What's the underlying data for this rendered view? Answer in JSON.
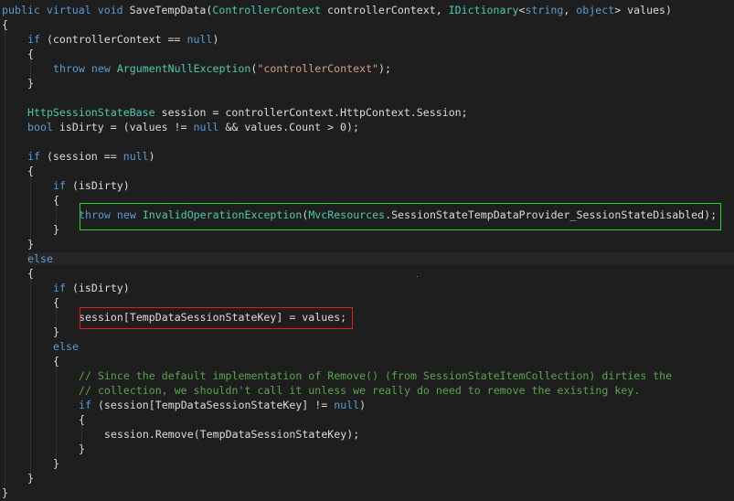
{
  "editor": {
    "language": "C#",
    "colors": {
      "background": "#1e1e1e",
      "keyword": "#569cd6",
      "type": "#4ec9b0",
      "string": "#d69d85",
      "comment": "#57a64a",
      "plain": "#dcdcdc",
      "highlight_green": "#2bd32b",
      "highlight_red": "#e21b1b"
    },
    "lines": [
      {
        "indent": 0,
        "tokens": [
          {
            "t": "public",
            "c": "kw"
          },
          {
            "t": " ",
            "c": "pl"
          },
          {
            "t": "virtual",
            "c": "kw"
          },
          {
            "t": " ",
            "c": "pl"
          },
          {
            "t": "void",
            "c": "kw"
          },
          {
            "t": " SaveTempData(",
            "c": "pl"
          },
          {
            "t": "ControllerContext",
            "c": "ty"
          },
          {
            "t": " controllerContext, ",
            "c": "pl"
          },
          {
            "t": "IDictionary",
            "c": "ty"
          },
          {
            "t": "<",
            "c": "pl"
          },
          {
            "t": "string",
            "c": "kw"
          },
          {
            "t": ", ",
            "c": "pl"
          },
          {
            "t": "object",
            "c": "kw"
          },
          {
            "t": "> values)",
            "c": "pl"
          }
        ]
      },
      {
        "indent": 0,
        "tokens": [
          {
            "t": "{",
            "c": "pl"
          }
        ]
      },
      {
        "indent": 4,
        "tokens": [
          {
            "t": "if",
            "c": "kw"
          },
          {
            "t": " (controllerContext == ",
            "c": "pl"
          },
          {
            "t": "null",
            "c": "kw"
          },
          {
            "t": ")",
            "c": "pl"
          }
        ]
      },
      {
        "indent": 4,
        "tokens": [
          {
            "t": "{",
            "c": "pl"
          }
        ]
      },
      {
        "indent": 8,
        "tokens": [
          {
            "t": "throw",
            "c": "kw"
          },
          {
            "t": " ",
            "c": "pl"
          },
          {
            "t": "new",
            "c": "kw"
          },
          {
            "t": " ",
            "c": "pl"
          },
          {
            "t": "ArgumentNullException",
            "c": "ty"
          },
          {
            "t": "(",
            "c": "pl"
          },
          {
            "t": "\"controllerContext\"",
            "c": "st"
          },
          {
            "t": ");",
            "c": "pl"
          }
        ]
      },
      {
        "indent": 4,
        "tokens": [
          {
            "t": "}",
            "c": "pl"
          }
        ]
      },
      {
        "indent": 0,
        "tokens": []
      },
      {
        "indent": 4,
        "tokens": [
          {
            "t": "HttpSessionStateBase",
            "c": "ty"
          },
          {
            "t": " session = controllerContext.HttpContext.Session;",
            "c": "pl"
          }
        ]
      },
      {
        "indent": 4,
        "tokens": [
          {
            "t": "bool",
            "c": "kw"
          },
          {
            "t": " isDirty = (values != ",
            "c": "pl"
          },
          {
            "t": "null",
            "c": "kw"
          },
          {
            "t": " && values.Count > 0);",
            "c": "pl"
          }
        ]
      },
      {
        "indent": 0,
        "tokens": []
      },
      {
        "indent": 4,
        "tokens": [
          {
            "t": "if",
            "c": "kw"
          },
          {
            "t": " (session == ",
            "c": "pl"
          },
          {
            "t": "null",
            "c": "kw"
          },
          {
            "t": ")",
            "c": "pl"
          }
        ]
      },
      {
        "indent": 4,
        "tokens": [
          {
            "t": "{",
            "c": "pl"
          }
        ]
      },
      {
        "indent": 8,
        "tokens": [
          {
            "t": "if",
            "c": "kw"
          },
          {
            "t": " (isDirty)",
            "c": "pl"
          }
        ]
      },
      {
        "indent": 8,
        "tokens": [
          {
            "t": "{",
            "c": "pl"
          }
        ]
      },
      {
        "indent": 12,
        "tokens": [
          {
            "t": "throw",
            "c": "kw"
          },
          {
            "t": " ",
            "c": "pl"
          },
          {
            "t": "new",
            "c": "kw"
          },
          {
            "t": " ",
            "c": "pl"
          },
          {
            "t": "InvalidOperationException",
            "c": "ty"
          },
          {
            "t": "(",
            "c": "pl"
          },
          {
            "t": "MvcResources",
            "c": "ty"
          },
          {
            "t": ".SessionStateTempDataProvider_SessionStateDisabled);",
            "c": "pl"
          }
        ]
      },
      {
        "indent": 8,
        "tokens": [
          {
            "t": "}",
            "c": "pl"
          }
        ]
      },
      {
        "indent": 4,
        "tokens": [
          {
            "t": "}",
            "c": "pl"
          }
        ]
      },
      {
        "indent": 4,
        "tokens": [
          {
            "t": "else",
            "c": "kw"
          }
        ]
      },
      {
        "indent": 4,
        "tokens": [
          {
            "t": "{",
            "c": "pl"
          }
        ]
      },
      {
        "indent": 8,
        "tokens": [
          {
            "t": "if",
            "c": "kw"
          },
          {
            "t": " (isDirty)",
            "c": "pl"
          }
        ]
      },
      {
        "indent": 8,
        "tokens": [
          {
            "t": "{",
            "c": "pl"
          }
        ]
      },
      {
        "indent": 12,
        "tokens": [
          {
            "t": "session[TempDataSessionStateKey] = values;",
            "c": "pl"
          }
        ]
      },
      {
        "indent": 8,
        "tokens": [
          {
            "t": "}",
            "c": "pl"
          }
        ]
      },
      {
        "indent": 8,
        "tokens": [
          {
            "t": "else",
            "c": "kw"
          }
        ]
      },
      {
        "indent": 8,
        "tokens": [
          {
            "t": "{",
            "c": "pl"
          }
        ]
      },
      {
        "indent": 12,
        "tokens": [
          {
            "t": "// Since the default implementation of Remove() (from SessionStateItemCollection) dirties the",
            "c": "cm"
          }
        ]
      },
      {
        "indent": 12,
        "tokens": [
          {
            "t": "// collection, we shouldn't call it unless we really do need to remove the existing key.",
            "c": "cm"
          }
        ]
      },
      {
        "indent": 12,
        "tokens": [
          {
            "t": "if",
            "c": "kw"
          },
          {
            "t": " (session[TempDataSessionStateKey] != ",
            "c": "pl"
          },
          {
            "t": "null",
            "c": "kw"
          },
          {
            "t": ")",
            "c": "pl"
          }
        ]
      },
      {
        "indent": 12,
        "tokens": [
          {
            "t": "{",
            "c": "pl"
          }
        ]
      },
      {
        "indent": 16,
        "tokens": [
          {
            "t": "session.Remove(TempDataSessionStateKey);",
            "c": "pl"
          }
        ]
      },
      {
        "indent": 12,
        "tokens": [
          {
            "t": "}",
            "c": "pl"
          }
        ]
      },
      {
        "indent": 8,
        "tokens": [
          {
            "t": "}",
            "c": "pl"
          }
        ]
      },
      {
        "indent": 4,
        "tokens": [
          {
            "t": "}",
            "c": "pl"
          }
        ]
      },
      {
        "indent": 0,
        "tokens": [
          {
            "t": "}",
            "c": "pl"
          }
        ]
      }
    ]
  }
}
